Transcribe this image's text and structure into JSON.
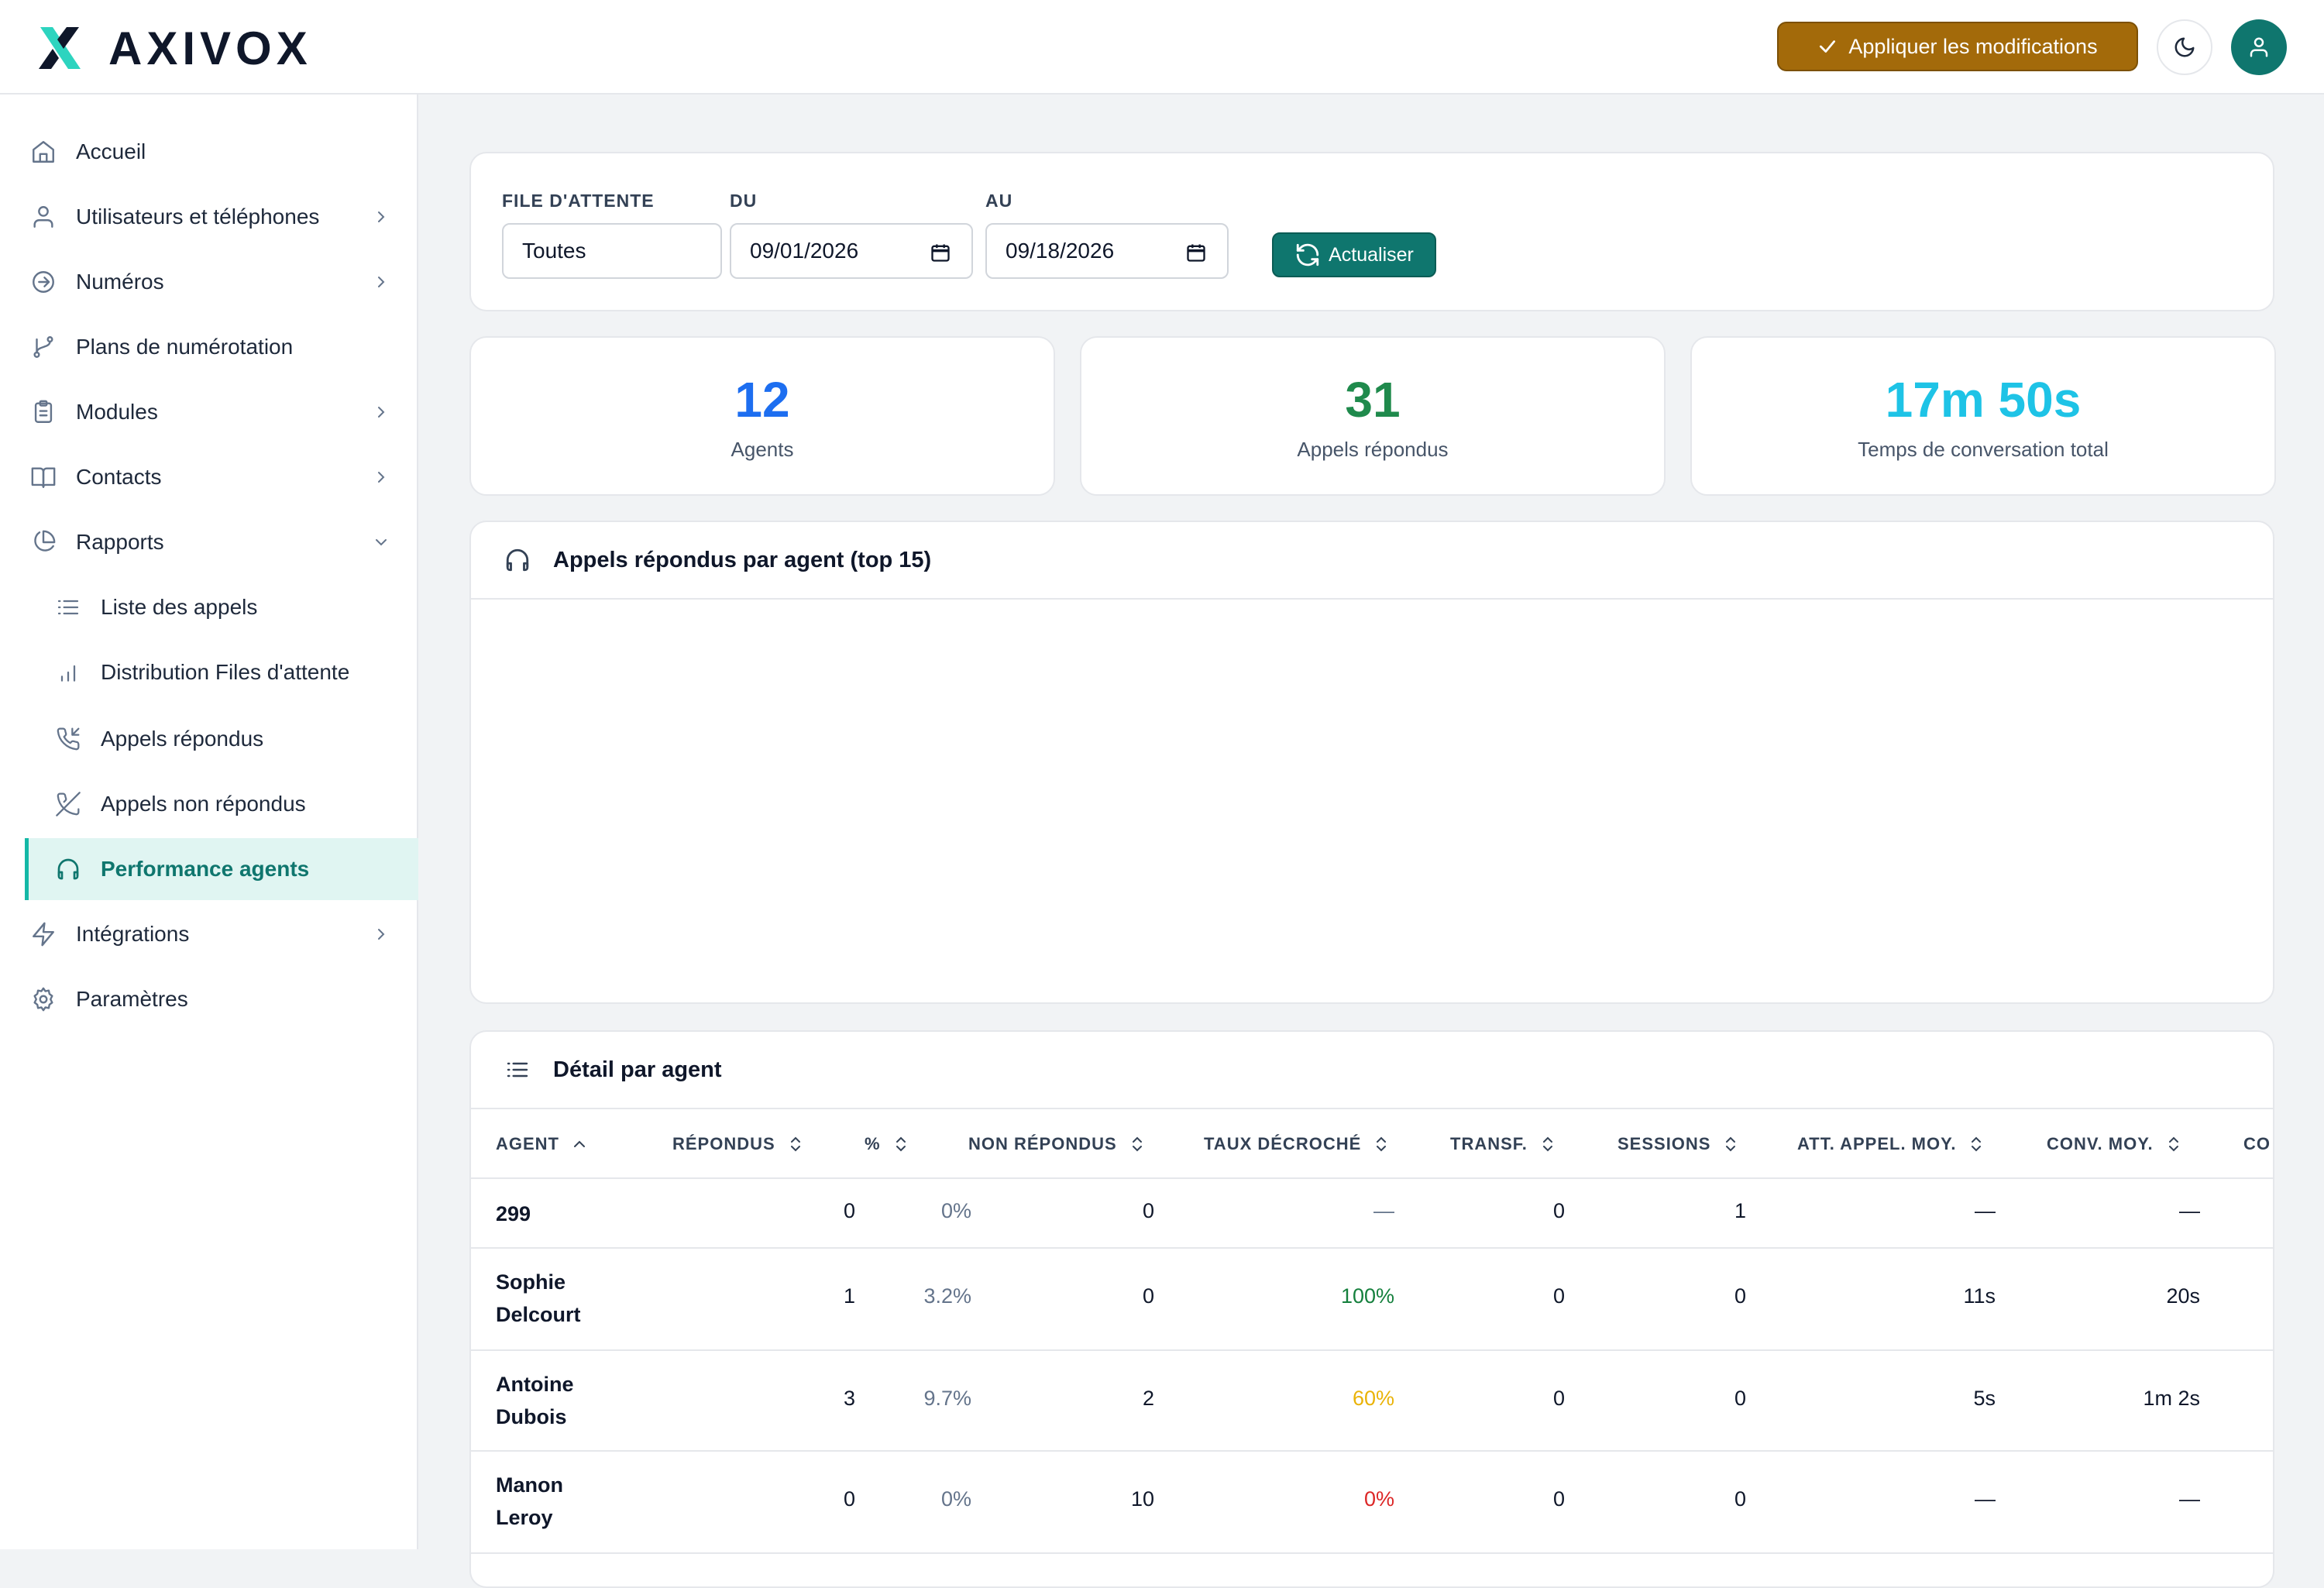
{
  "brand": {
    "name": "AXIVOX"
  },
  "header": {
    "apply_label": "Appliquer les modifications",
    "apply_icon": "check-icon",
    "theme_icon": "moon-icon",
    "user_icon": "user-icon"
  },
  "sidebar": {
    "items": [
      {
        "label": "Accueil",
        "icon": "home-icon"
      },
      {
        "label": "Utilisateurs et téléphones",
        "icon": "user-icon"
      },
      {
        "label": "Numéros",
        "icon": "arrow-circle-icon"
      },
      {
        "label": "Plans de numérotation",
        "icon": "git-branch-icon"
      },
      {
        "label": "Modules",
        "icon": "clipboard-icon"
      },
      {
        "label": "Contacts",
        "icon": "book-icon"
      },
      {
        "label": "Rapports",
        "icon": "pie-chart-icon"
      },
      {
        "label": "Liste des appels",
        "icon": "list-icon"
      },
      {
        "label": "Distribution Files d'attente",
        "icon": "bar-chart-icon"
      },
      {
        "label": "Appels répondus",
        "icon": "phone-incoming-icon"
      },
      {
        "label": "Appels non répondus",
        "icon": "phone-missed-icon"
      },
      {
        "label": "Performance agents",
        "icon": "headphones-icon"
      },
      {
        "label": "Intégrations",
        "icon": "zap-icon"
      },
      {
        "label": "Paramètres",
        "icon": "settings-icon"
      }
    ]
  },
  "filters": {
    "queue_label": "FILE D'ATTENTE",
    "queue_value": "Toutes",
    "from_label": "DU",
    "from_value": "09/01/2026",
    "to_label": "AU",
    "to_value": "09/18/2026",
    "refresh_label": "Actualiser"
  },
  "stats": [
    {
      "value": "12",
      "label": "Agents",
      "color": "#1d6ef0"
    },
    {
      "value": "31",
      "label": "Appels répondus",
      "color": "#1f8a4c"
    },
    {
      "value": "17m 50s",
      "label": "Temps de conversation total",
      "color": "#1ec3e6"
    }
  ],
  "chart": {
    "title": "Appels répondus par agent (top 15)"
  },
  "table": {
    "title": "Détail par agent",
    "columns": [
      "AGENT",
      "RÉPONDUS",
      "%",
      "NON RÉPONDUS",
      "TAUX DÉCROCHÉ",
      "TRANSF.",
      "SESSIONS",
      "ATT. APPEL. MOY.",
      "CONV. MOY.",
      "CO"
    ],
    "rows": [
      {
        "agent": "299",
        "repondus": "0",
        "pct": "0%",
        "non_repondus": "0",
        "taux": "—",
        "transf": "0",
        "sessions": "1",
        "att": "—",
        "conv": "—"
      },
      {
        "agent": "Sophie Delcourt",
        "repondus": "1",
        "pct": "3.2%",
        "non_repondus": "0",
        "taux": "100%",
        "transf": "0",
        "sessions": "0",
        "att": "11s",
        "conv": "20s"
      },
      {
        "agent": "Antoine Dubois",
        "repondus": "3",
        "pct": "9.7%",
        "non_repondus": "2",
        "taux": "60%",
        "transf": "0",
        "sessions": "0",
        "att": "5s",
        "conv": "1m 2s"
      },
      {
        "agent": "Manon Leroy",
        "repondus": "0",
        "pct": "0%",
        "non_repondus": "10",
        "taux": "0%",
        "transf": "0",
        "sessions": "0",
        "att": "—",
        "conv": "—"
      }
    ]
  }
}
